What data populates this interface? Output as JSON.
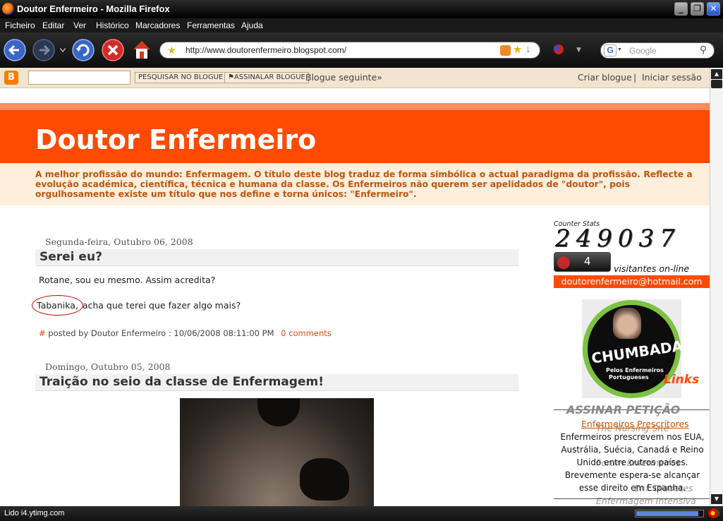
{
  "window": {
    "title": "Doutor Enfermeiro - Mozilla Firefox"
  },
  "menu": [
    "Ficheiro",
    "Editar",
    "Ver",
    "Histórico",
    "Marcadores",
    "Ferramentas",
    "Ajuda"
  ],
  "address_bar": {
    "url": "http://www.doutorenfermeiro.blogspot.com/"
  },
  "search": {
    "placeholder": "Google"
  },
  "blogger_bar": {
    "search_button": "PESQUISAR NO BLOGUE",
    "flag_button": "ASSINALAR BLOGUE",
    "next_blog": "Blogue seguinte»",
    "create_blog": "Criar blogue",
    "separator": "|",
    "sign_in": "Iniciar sessão"
  },
  "blog": {
    "title": "Doutor Enfermeiro",
    "description": "A melhor profissão do mundo: Enfermagem. O título deste blog traduz de forma simbólica o actual paradigma da profissão. Reflecte a evolução académica, científica, técnica e humana da classe. Os Enfermeiros não querem ser apelidados de \"doutor\", pois orgulhosamente existe um título que nos define e torna únicos: \"Enfermeiro\"."
  },
  "posts": [
    {
      "date": "Segunda-feira, Outubro 06, 2008",
      "title": "Serei eu?",
      "line1": "Rotane, sou eu mesmo. Assim acredita?",
      "line2_name": "Tabanika,",
      "line2_rest": " acha que terei que fazer algo mais?",
      "hash": "#",
      "posted_by": " posted by Doutor Enfermeiro : 10/06/2008 08:11:00 PM",
      "comments": "0 comments"
    },
    {
      "date": "Domingo, Outubro 05, 2008",
      "title": "Traição no seio da classe de Enfermagem!"
    }
  ],
  "sidebar": {
    "counter_label": "Counter Stats",
    "counter_digits": "249037",
    "online_count": "4",
    "online_label": "visitantes on-line",
    "email": "doutorenfermeiro@hotmail.com",
    "badge_main": "CHUMBADA!",
    "badge_line1": "Pelos Enfermeiros",
    "badge_line2": "Portugueses",
    "links_heading": "Links",
    "petition_heading": "ASSINAR PETIÇÃO",
    "petition_link": "Enfermeiros Prescritores",
    "petition_text": "Enfermeiros prescrevem nos EUA, Austrália, Suécia, Canadá e Reino Unido entre outros países. Brevemente espera-se alcançar esse direito em Espanha.",
    "overlap_1": "The Nursing Site",
    "overlap_2": "Forum Enfermeiros",
    "overlap_3": "Enf. Diabetes",
    "overlap_4": "Enfermagem Intensiva"
  },
  "status": {
    "text": "Lido i4.ytimg.com"
  }
}
